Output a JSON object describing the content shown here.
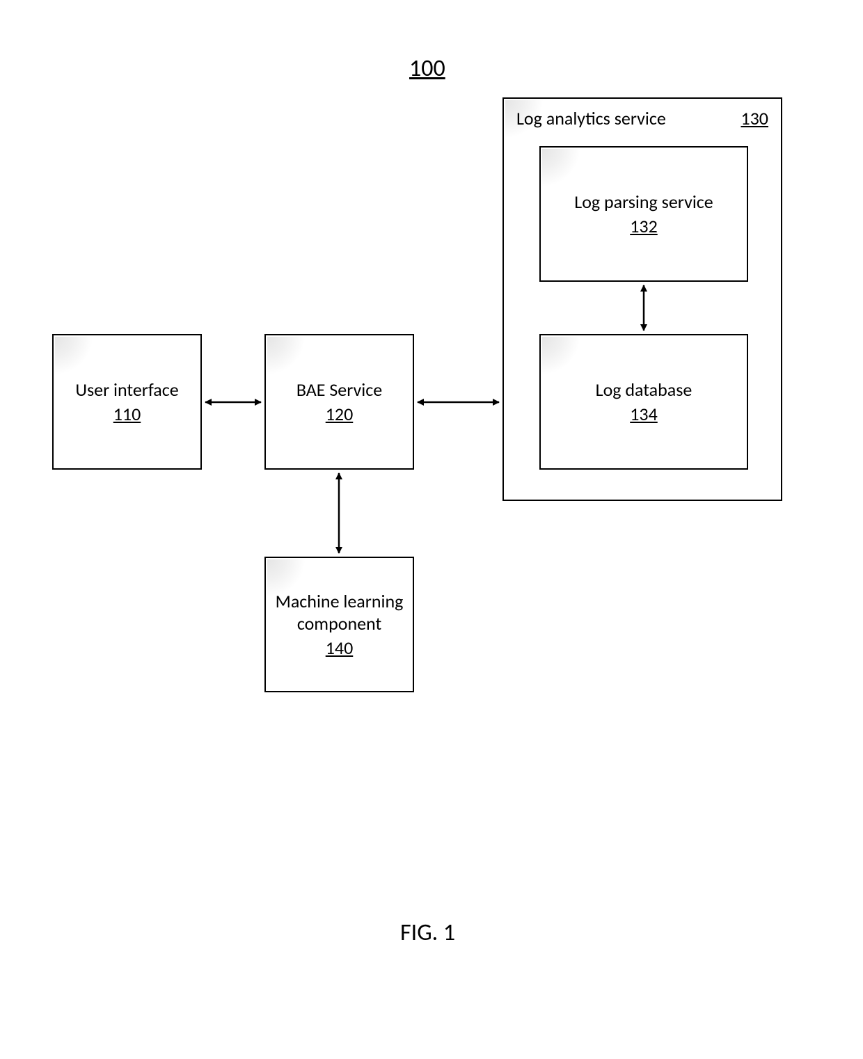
{
  "figure": {
    "title_ref": "100",
    "caption": "FIG. 1"
  },
  "blocks": {
    "user_interface": {
      "label": "User interface",
      "ref": "110"
    },
    "bae_service": {
      "label": "BAE Service",
      "ref": "120"
    },
    "ml_component": {
      "label_l1": "Machine learning",
      "label_l2": "component",
      "ref": "140"
    },
    "log_analytics": {
      "label": "Log analytics service",
      "ref": "130"
    },
    "log_parsing": {
      "label": "Log parsing service",
      "ref": "132"
    },
    "log_database": {
      "label": "Log database",
      "ref": "134"
    }
  }
}
